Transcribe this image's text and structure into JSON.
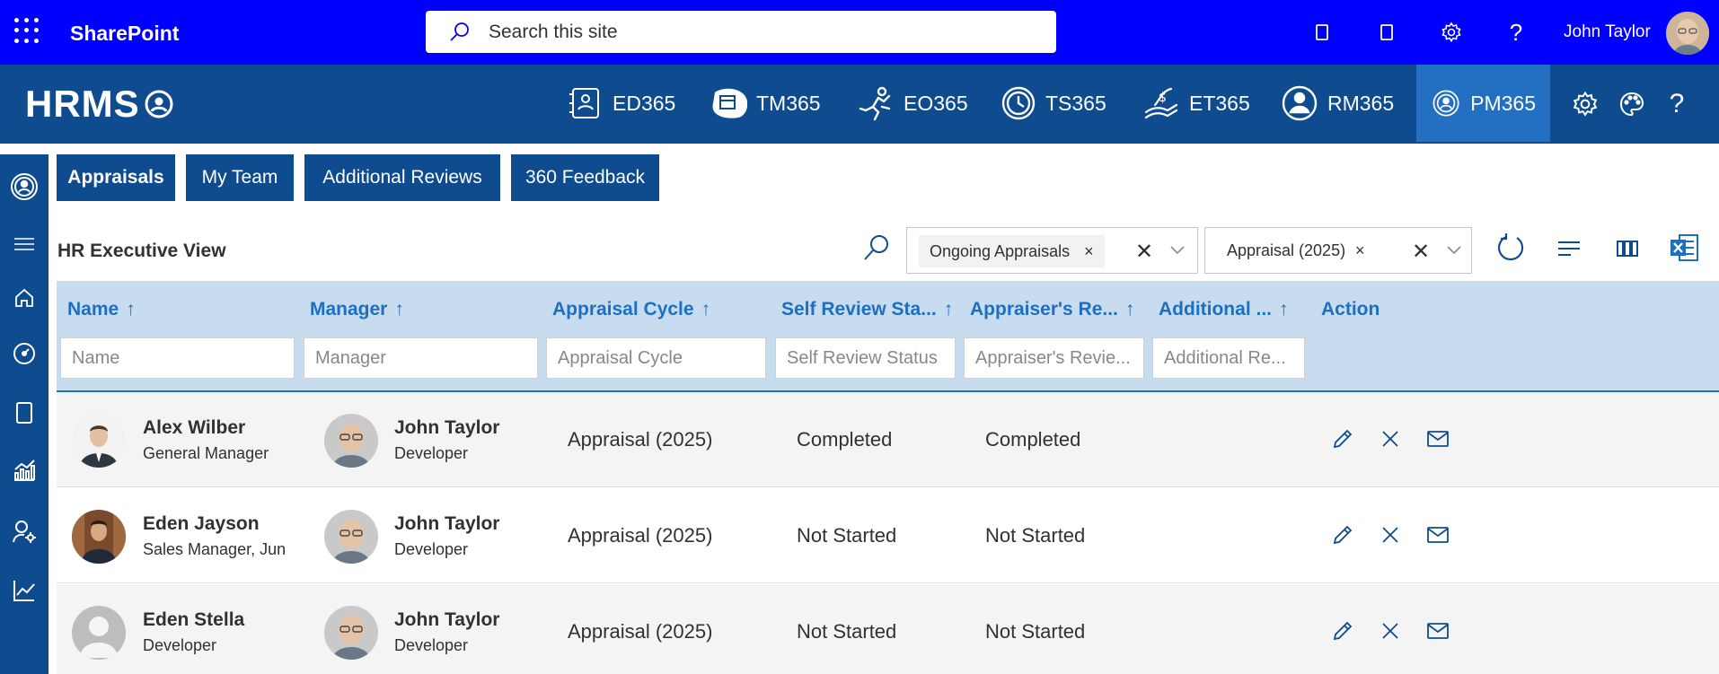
{
  "sharepoint": {
    "title": "SharePoint",
    "search_placeholder": "Search this site",
    "user_name": "John Taylor"
  },
  "hrms": {
    "logo": "HRMS",
    "modules": [
      {
        "label": "ED365",
        "icon": "id-card-icon"
      },
      {
        "label": "TM365",
        "icon": "calendar-icon"
      },
      {
        "label": "EO365",
        "icon": "running-person-icon"
      },
      {
        "label": "TS365",
        "icon": "clock-icon"
      },
      {
        "label": "ET365",
        "icon": "expense-hand-icon"
      },
      {
        "label": "RM365",
        "icon": "person-icon"
      },
      {
        "label": "PM365",
        "icon": "performance-icon"
      }
    ],
    "active_module": "PM365"
  },
  "tabs": [
    {
      "label": "Appraisals",
      "active": true
    },
    {
      "label": "My Team",
      "active": false
    },
    {
      "label": "Additional Reviews",
      "active": false
    },
    {
      "label": "360 Feedback",
      "active": false
    }
  ],
  "view": {
    "title": "HR Executive View",
    "filter1": {
      "value": "Ongoing Appraisals",
      "remove": "×",
      "clear": "✕"
    },
    "filter2": {
      "value": "Appraisal (2025)",
      "remove": "×",
      "clear": "✕"
    }
  },
  "table": {
    "columns": [
      {
        "label": "Name",
        "sort": "↑",
        "filter_placeholder": "Name"
      },
      {
        "label": "Manager",
        "sort": "↑",
        "filter_placeholder": "Manager"
      },
      {
        "label": "Appraisal Cycle",
        "sort": "↑",
        "filter_placeholder": "Appraisal Cycle"
      },
      {
        "label": "Self Review Sta...",
        "sort": "↑",
        "filter_placeholder": "Self Review Status"
      },
      {
        "label": "Appraiser's Re...",
        "sort": "↑",
        "filter_placeholder": "Appraiser's Revie..."
      },
      {
        "label": "Additional ...",
        "sort": "↑",
        "filter_placeholder": "Additional Re..."
      },
      {
        "label": "Action"
      }
    ],
    "rows": [
      {
        "name": "Alex Wilber",
        "title": "General Manager",
        "manager": "John Taylor",
        "manager_title": "Developer",
        "cycle": "Appraisal (2025)",
        "self_status": "Completed",
        "appraiser_status": "Completed"
      },
      {
        "name": "Eden Jayson",
        "title": "Sales Manager, Junic",
        "manager": "John Taylor",
        "manager_title": "Developer",
        "cycle": "Appraisal (2025)",
        "self_status": "Not Started",
        "appraiser_status": "Not Started"
      },
      {
        "name": "Eden Stella",
        "title": "Developer",
        "manager": "John Taylor",
        "manager_title": "Developer",
        "cycle": "Appraisal (2025)",
        "self_status": "Not Started",
        "appraiser_status": "Not Started"
      }
    ]
  },
  "colors": {
    "sharepoint_bar": "#0000ff",
    "hrms_bar": "#0f4c8f",
    "active_module": "#2370c2",
    "table_header": "#c7dcef",
    "header_text": "#1e6fc0"
  }
}
